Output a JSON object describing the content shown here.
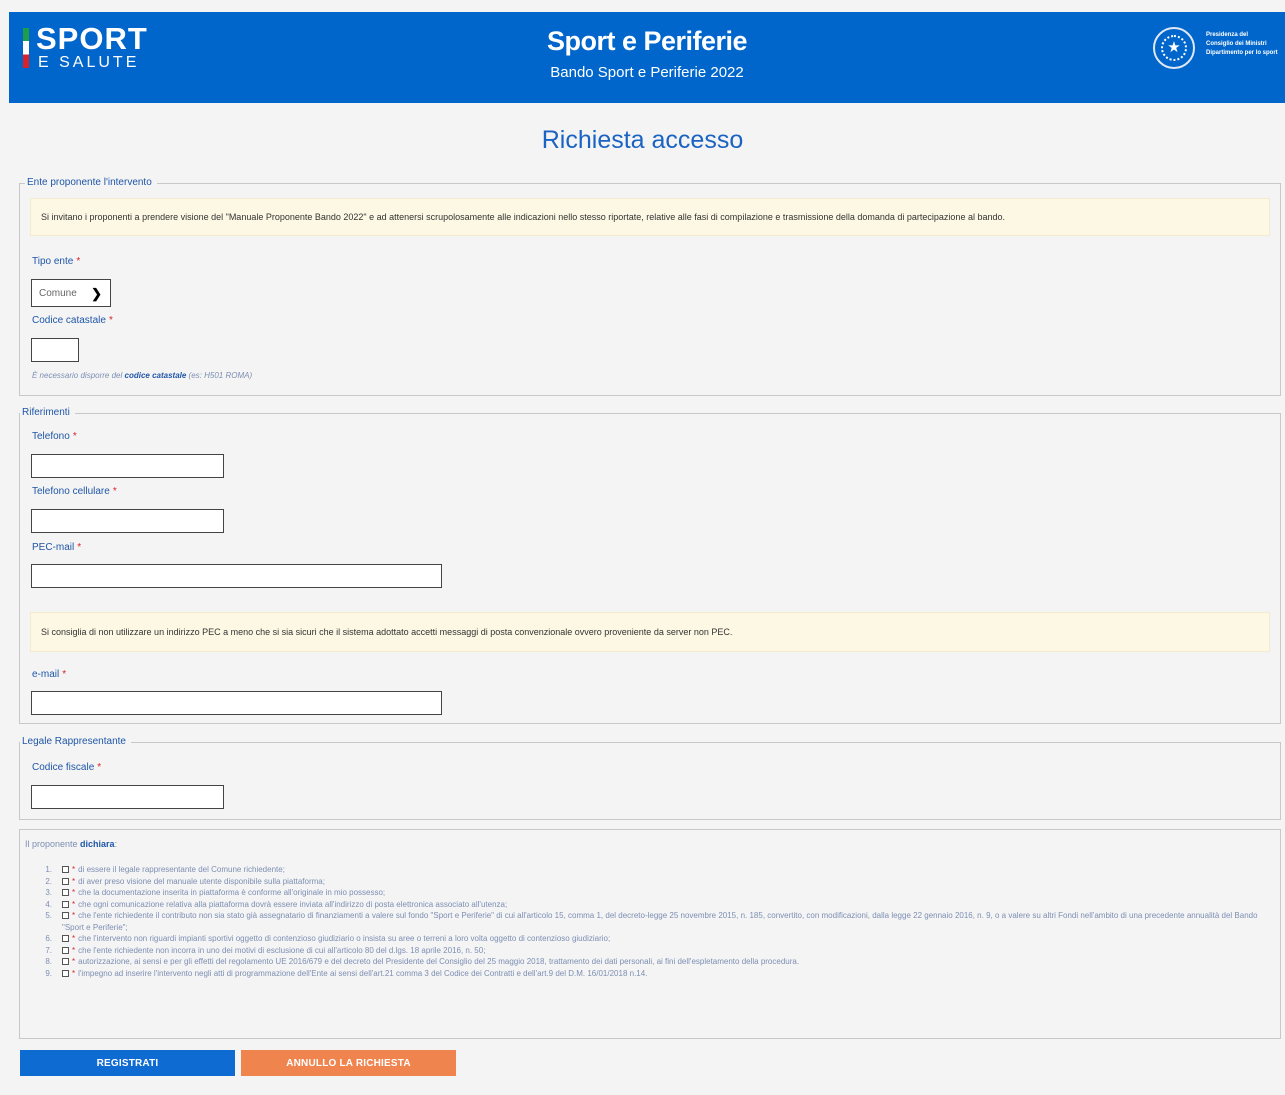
{
  "header": {
    "logo_sport": "SPORT",
    "logo_salute": "E SALUTE",
    "title": "Sport e Periferie",
    "subtitle": "Bando Sport e Periferie 2022",
    "gov_lines": [
      "Presidenza del",
      "Consiglio dei Ministri",
      "Dipartimento per lo sport"
    ],
    "emblem_icon": "repubblica-emblem-icon"
  },
  "page_title": "Richiesta accesso",
  "ente": {
    "legend": "Ente proponente l'intervento",
    "notice": "Si invitano i proponenti a prendere visione del \"Manuale Proponente Bando 2022\" e ad attenersi scrupolosamente alle indicazioni nello stesso riportate, relative alle fasi di compilazione e trasmissione della domanda di partecipazione al bando.",
    "tipo_label": "Tipo ente",
    "tipo_value": "Comune",
    "codice_label": "Codice catastale",
    "codice_value": "",
    "help_prefix": "È necessario disporre del ",
    "help_bold": "codice catastale",
    "help_suffix": " (es: H501 ROMA)"
  },
  "riferimenti": {
    "legend": "Riferimenti",
    "telefono_label": "Telefono",
    "cellulare_label": "Telefono cellulare",
    "pec_label": "PEC-mail",
    "pec_notice": "Si consiglia di non utilizzare un indirizzo PEC a meno che si sia sicuri che il sistema adottato accetti messaggi di posta convenzionale ovvero proveniente da server non PEC.",
    "email_label": "e-mail"
  },
  "legale": {
    "legend": "Legale Rappresentante",
    "cf_label": "Codice fiscale"
  },
  "required_mark": "*",
  "declarations": {
    "intro_prefix": "Il proponente ",
    "intro_bold": "dichiara",
    "intro_suffix": ":",
    "items": [
      {
        "num": "1.",
        "text": "di essere il legale rappresentante del Comune richiedente;"
      },
      {
        "num": "2.",
        "text": "di aver preso visione del manuale utente disponibile sulla piattaforma;"
      },
      {
        "num": "3.",
        "text": "che la documentazione inserita in piattaforma è conforme all'originale in mio possesso;"
      },
      {
        "num": "4.",
        "text": "che ogni comunicazione relativa alla piattaforma dovrà essere inviata all'indirizzo di posta elettronica associato all'utenza;"
      },
      {
        "num": "5.",
        "text": "che l'ente richiedente il contributo non sia stato già assegnatario di finanziamenti a valere sul fondo \"Sport e Periferie\" di cui all'articolo 15, comma 1, del decreto-legge 25 novembre 2015, n. 185, convertito, con modificazioni, dalla legge 22 gennaio 2016, n. 9, o a valere su altri Fondi nell'ambito di una precedente annualità del Bando \"Sport e Periferie\";"
      },
      {
        "num": "6.",
        "text": "che l'intervento non riguardi impianti sportivi oggetto di contenzioso giudiziario o insista su aree o terreni a loro volta oggetto di contenzioso giudiziario;"
      },
      {
        "num": "7.",
        "text": "che l'ente richiedente non incorra in uno dei motivi di esclusione di cui all'articolo 80 del d.lgs. 18 aprile 2016, n. 50;"
      },
      {
        "num": "8.",
        "text": "autorizzazione, ai sensi e per gli effetti del regolamento UE 2016/679 e del decreto del Presidente del Consiglio del 25 maggio 2018, trattamento dei dati personali, ai fini dell'espletamento della procedura."
      },
      {
        "num": "9.",
        "text": "l'impegno ad inserire l'intervento negli atti di programmazione dell'Ente ai sensi dell'art.21 comma 3 del Codice dei Contratti e dell'art.9 del D.M. 16/01/2018 n.14."
      }
    ]
  },
  "buttons": {
    "register": "REGISTRATI",
    "cancel": "ANNULLO LA RICHIESTA"
  },
  "colors": {
    "header_bg": "#0066cc",
    "title": "#1b63c2",
    "primary_button": "#0d6bd1",
    "cancel_button": "#f0844f",
    "notice_bg": "#fcf8e3"
  }
}
